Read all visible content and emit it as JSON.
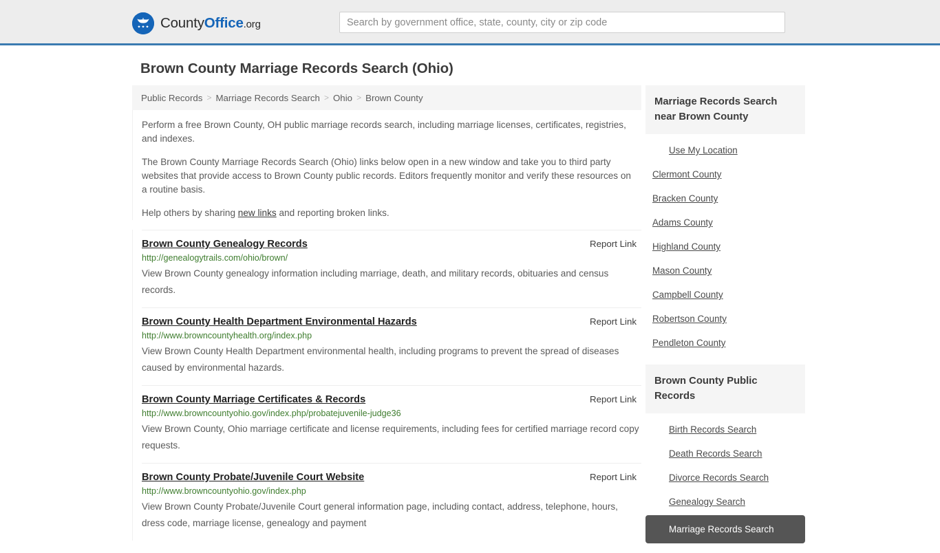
{
  "header": {
    "brand": {
      "part1": "County",
      "part2": "Office",
      "part3": ".org",
      "icon": "eagle-shield-logo"
    },
    "search": {
      "placeholder": "Search by government office, state, county, city or zip code",
      "value": ""
    }
  },
  "page": {
    "title": "Brown County Marriage Records Search (Ohio)"
  },
  "breadcrumb": {
    "items": [
      {
        "label": "Public Records"
      },
      {
        "label": "Marriage Records Search"
      },
      {
        "label": "Ohio"
      },
      {
        "label": "Brown County"
      }
    ],
    "separator": ">"
  },
  "intro": {
    "paragraph1": "Perform a free Brown County, OH public marriage records search, including marriage licenses, certificates, registries, and indexes.",
    "paragraph2": "The Brown County Marriage Records Search (Ohio) links below open in a new window and take you to third party websites that provide access to Brown County public records. Editors frequently monitor and verify these resources on a routine basis.",
    "paragraph3_before": "Help others by sharing ",
    "paragraph3_link": "new links",
    "paragraph3_after": " and reporting broken links."
  },
  "results": {
    "report_label": "Report Link",
    "items": [
      {
        "title": "Brown County Genealogy Records",
        "url": "http://genealogytrails.com/ohio/brown/",
        "description": "View Brown County genealogy information including marriage, death, and military records, obituaries and census records."
      },
      {
        "title": "Brown County Health Department Environmental Hazards",
        "url": "http://www.browncountyhealth.org/index.php",
        "description": "View Brown County Health Department environmental health, including programs to prevent the spread of diseases caused by environmental hazards."
      },
      {
        "title": "Brown County Marriage Certificates & Records",
        "url": "http://www.browncountyohio.gov/index.php/probatejuvenile-judge36",
        "description": "View Brown County, Ohio marriage certificate and license requirements, including fees for certified marriage record copy requests."
      },
      {
        "title": "Brown County Probate/Juvenile Court Website",
        "url": "http://www.browncountyohio.gov/index.php",
        "description": "View Brown County Probate/Juvenile Court general information page, including contact, address, telephone, hours, dress code, marriage license, genealogy and payment"
      }
    ]
  },
  "sidebar": {
    "nearby": {
      "heading": "Marriage Records Search near Brown County",
      "use_my_location": "Use My Location",
      "counties": [
        "Clermont County",
        "Bracken County",
        "Adams County",
        "Highland County",
        "Mason County",
        "Campbell County",
        "Robertson County",
        "Pendleton County"
      ]
    },
    "public_records": {
      "heading": "Brown County Public Records",
      "links": [
        {
          "label": "Birth Records Search",
          "active": false
        },
        {
          "label": "Death Records Search",
          "active": false
        },
        {
          "label": "Divorce Records Search",
          "active": false
        },
        {
          "label": "Genealogy Search",
          "active": false
        },
        {
          "label": "Marriage Records Search",
          "active": true
        }
      ]
    }
  },
  "colors": {
    "brand_blue": "#1565b8",
    "header_rule": "#3a7ab0",
    "header_bg": "#ededed",
    "panel_bg": "#f5f5f5",
    "url_green": "#3f7d2f",
    "active_bg": "#555555"
  }
}
